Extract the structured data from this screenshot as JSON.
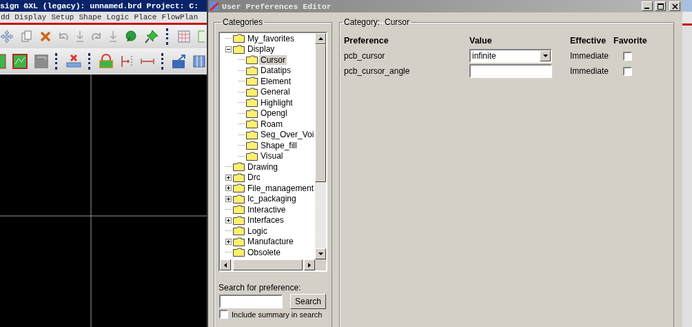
{
  "app": {
    "title": "sign GXL (legacy): unnamed.brd  Project: C:",
    "menu": [
      "dd",
      "Display",
      "Setup",
      "Shape",
      "Logic",
      "Place",
      "FlowPlan"
    ]
  },
  "dialog": {
    "title": "User Preferences Editor",
    "categories": {
      "label": "Categories",
      "tree": [
        {
          "label": "My_favorites",
          "kind": "leaf",
          "selected": false
        },
        {
          "label": "Display",
          "kind": "expanded",
          "selected": false,
          "children": [
            {
              "label": "Cursor",
              "kind": "leaf",
              "selected": true
            },
            {
              "label": "Datatips",
              "kind": "leaf",
              "selected": false
            },
            {
              "label": "Element",
              "kind": "leaf",
              "selected": false
            },
            {
              "label": "General",
              "kind": "leaf",
              "selected": false
            },
            {
              "label": "Highlight",
              "kind": "leaf",
              "selected": false
            },
            {
              "label": "Opengl",
              "kind": "leaf",
              "selected": false
            },
            {
              "label": "Roam",
              "kind": "leaf",
              "selected": false
            },
            {
              "label": "Seg_Over_Voi",
              "kind": "leaf",
              "selected": false
            },
            {
              "label": "Shape_fill",
              "kind": "leaf",
              "selected": false
            },
            {
              "label": "Visual",
              "kind": "leaf",
              "selected": false
            }
          ]
        },
        {
          "label": "Drawing",
          "kind": "leaf",
          "selected": false
        },
        {
          "label": "Drc",
          "kind": "collapsed",
          "selected": false
        },
        {
          "label": "File_management",
          "kind": "collapsed",
          "selected": false
        },
        {
          "label": "Ic_packaging",
          "kind": "collapsed",
          "selected": false
        },
        {
          "label": "Interactive",
          "kind": "leaf",
          "selected": false
        },
        {
          "label": "Interfaces",
          "kind": "collapsed",
          "selected": false
        },
        {
          "label": "Logic",
          "kind": "leaf",
          "selected": false
        },
        {
          "label": "Manufacture",
          "kind": "collapsed",
          "selected": false
        },
        {
          "label": "Obsolete",
          "kind": "leaf",
          "selected": false
        }
      ]
    },
    "search": {
      "label": "Search for preference:",
      "button": "Search",
      "include_summary": {
        "label": "Include summary in search",
        "checked": false
      }
    },
    "category": {
      "label": "Category:",
      "name": "Cursor",
      "columns": [
        "Preference",
        "Value",
        "Effective",
        "Favorite"
      ],
      "rows": [
        {
          "name": "pcb_cursor",
          "kind": "dropdown",
          "value": "infinite",
          "effective": "Immediate",
          "favorite": false
        },
        {
          "name": "pcb_cursor_angle",
          "kind": "text",
          "effective": "Immediate",
          "favorite": false
        }
      ]
    }
  }
}
